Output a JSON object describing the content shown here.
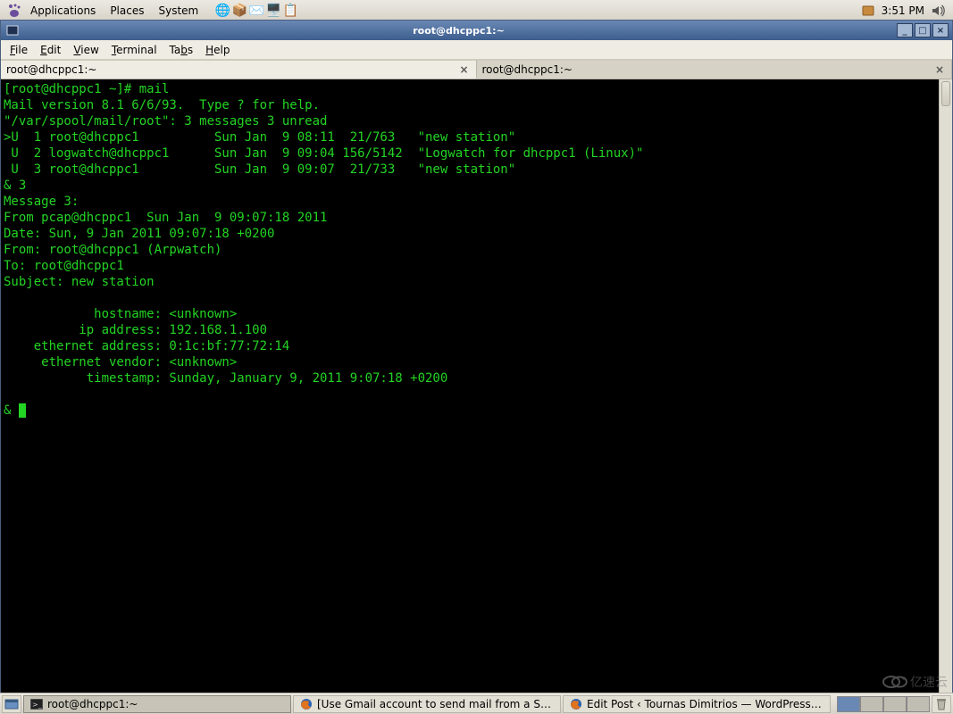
{
  "top_panel": {
    "menus": {
      "applications": "Applications",
      "places": "Places",
      "system": "System"
    },
    "clock": "3:51 PM"
  },
  "window": {
    "title": "root@dhcppc1:~",
    "menubar": {
      "file": "File",
      "edit": "Edit",
      "view": "View",
      "terminal": "Terminal",
      "tabs": "Tabs",
      "help": "Help"
    },
    "tabs": [
      "root@dhcppc1:~",
      "root@dhcppc1:~"
    ],
    "active_tab": 0
  },
  "terminal": {
    "lines": [
      "[root@dhcppc1 ~]# mail",
      "Mail version 8.1 6/6/93.  Type ? for help.",
      "\"/var/spool/mail/root\": 3 messages 3 unread",
      ">U  1 root@dhcppc1          Sun Jan  9 08:11  21/763   \"new station\"",
      " U  2 logwatch@dhcppc1      Sun Jan  9 09:04 156/5142  \"Logwatch for dhcppc1 (Linux)\"",
      " U  3 root@dhcppc1          Sun Jan  9 09:07  21/733   \"new station\"",
      "& 3",
      "Message 3:",
      "From pcap@dhcppc1  Sun Jan  9 09:07:18 2011",
      "Date: Sun, 9 Jan 2011 09:07:18 +0200",
      "From: root@dhcppc1 (Arpwatch)",
      "To: root@dhcppc1",
      "Subject: new station",
      "",
      "            hostname: <unknown>",
      "          ip address: 192.168.1.100",
      "    ethernet address: 0:1c:bf:77:72:14",
      "     ethernet vendor: <unknown>",
      "           timestamp: Sunday, January 9, 2011 9:07:18 +0200",
      "",
      "& "
    ]
  },
  "taskbar": {
    "items": [
      {
        "icon": "terminal",
        "label": "root@dhcppc1:~",
        "pressed": true
      },
      {
        "icon": "firefox",
        "label": "[Use Gmail account to send mail from a Shell pro...",
        "pressed": false
      },
      {
        "icon": "firefox",
        "label": "Edit Post ‹ Tournas Dimitrios — WordPress - Mozilla...",
        "pressed": false
      }
    ]
  },
  "watermark": "亿速云"
}
